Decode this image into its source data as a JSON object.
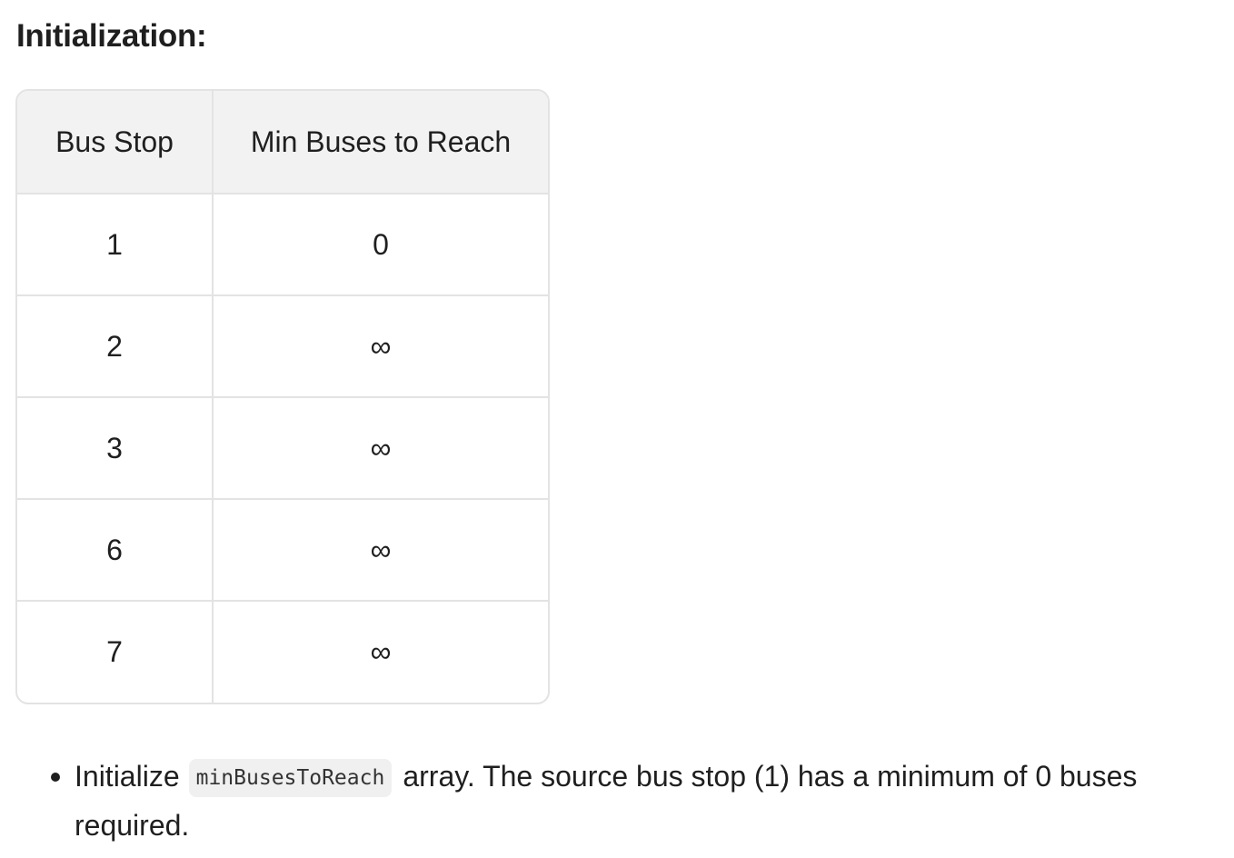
{
  "heading": "Initialization:",
  "table": {
    "headers": [
      "Bus Stop",
      "Min Buses to Reach"
    ],
    "rows": [
      [
        "1",
        "0"
      ],
      [
        "2",
        "∞"
      ],
      [
        "3",
        "∞"
      ],
      [
        "6",
        "∞"
      ],
      [
        "7",
        "∞"
      ]
    ]
  },
  "bullets": [
    {
      "prefix": "Initialize",
      "code": "minBusesToReach",
      "suffix": "array. The source bus stop (1) has a minimum of 0 buses required."
    }
  ]
}
